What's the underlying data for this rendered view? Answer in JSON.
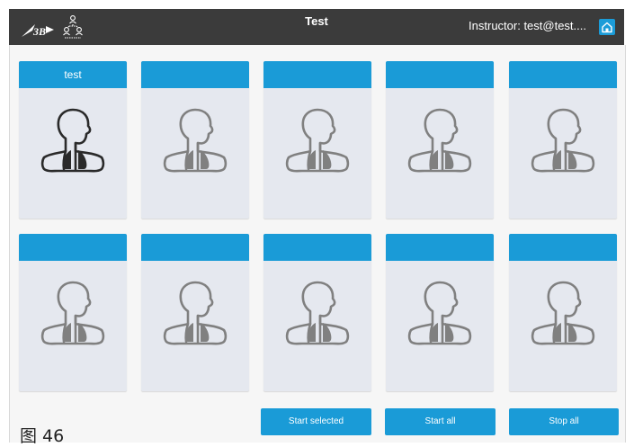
{
  "header": {
    "title": "Test",
    "instructor": "Instructor: test@test....",
    "logo_icon": "3b-logo-icon",
    "network_icon": "network-users-icon",
    "home_icon": "home-icon"
  },
  "cards": [
    {
      "label": "test",
      "active": true
    },
    {
      "label": "",
      "active": false
    },
    {
      "label": "",
      "active": false
    },
    {
      "label": "",
      "active": false
    },
    {
      "label": "",
      "active": false
    },
    {
      "label": "",
      "active": false
    },
    {
      "label": "",
      "active": false
    },
    {
      "label": "",
      "active": false
    },
    {
      "label": "",
      "active": false
    },
    {
      "label": "",
      "active": false
    }
  ],
  "actions": {
    "start_selected": "Start selected",
    "start_all": "Start all",
    "stop_all": "Stop all"
  },
  "caption": "图 46",
  "colors": {
    "topbar": "#3b3b3b",
    "accent": "#1a9bd7",
    "card_bg": "#e5e8ef",
    "icon_active": "#2a2a2a",
    "icon_inactive": "#808080"
  }
}
